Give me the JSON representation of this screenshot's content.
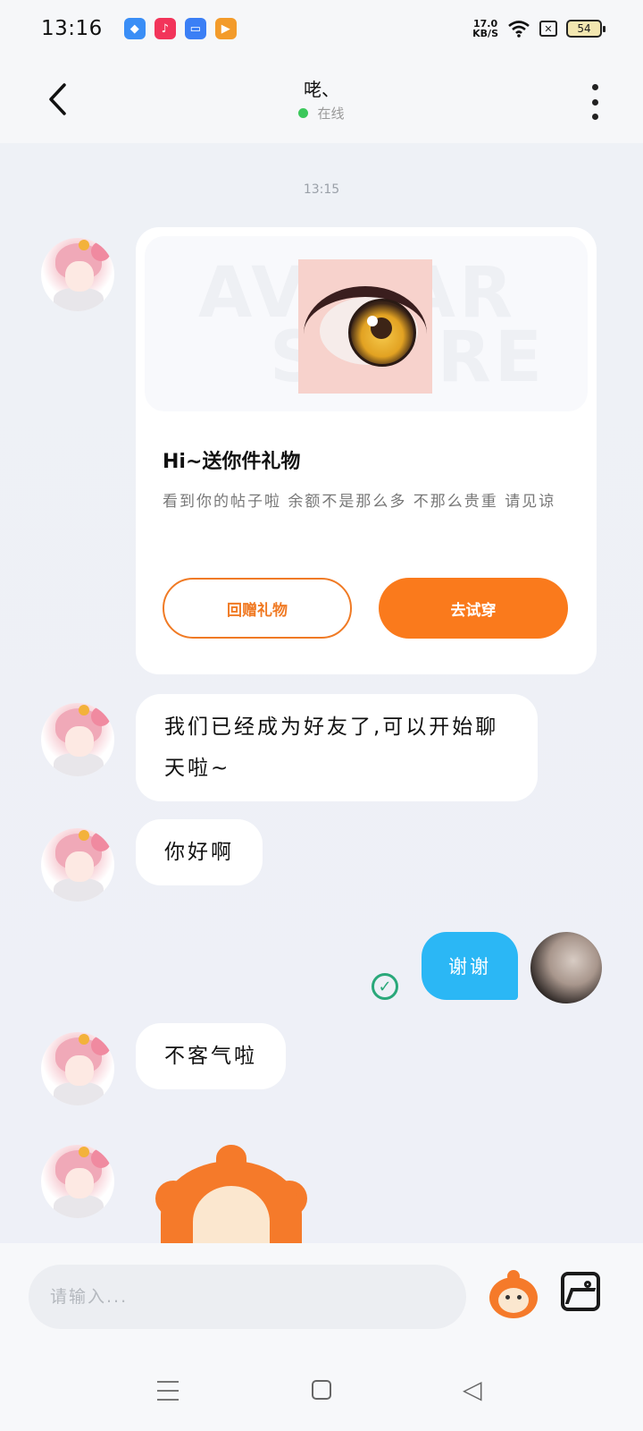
{
  "status": {
    "time": "13:16",
    "net_speed_value": "17.0",
    "net_speed_unit": "KB/S",
    "battery": "54",
    "apps": [
      {
        "icon": "browser-icon",
        "color": "#3a8ef6"
      },
      {
        "icon": "music-icon",
        "color": "#f2345a"
      },
      {
        "icon": "tv-icon",
        "color": "#3b7ff5"
      },
      {
        "icon": "video-icon",
        "color": "#f39b2a"
      }
    ]
  },
  "header": {
    "name": "咾、",
    "online_status": "在线",
    "online_color": "#3bc85b"
  },
  "chat": {
    "timestamp": "13:15",
    "gift_card": {
      "watermark_line1": "AVATAR",
      "watermark_line2": "STORE",
      "title": "Hi~送你件礼物",
      "description": "看到你的帖子啦  余额不是那么多  不那么贵重  请见谅",
      "return_gift_label": "回赠礼物",
      "try_on_label": "去试穿"
    },
    "messages": [
      {
        "direction": "in",
        "text": "我们已经成为好友了,可以开始聊天啦~"
      },
      {
        "direction": "in",
        "text": "你好啊"
      },
      {
        "direction": "out",
        "text": "谢谢",
        "read": true
      },
      {
        "direction": "in",
        "text": "不客气啦"
      }
    ],
    "bubble_out_color": "#2bb7f5",
    "accent_color": "#fa7a1c"
  },
  "input": {
    "placeholder": "请输入..."
  }
}
